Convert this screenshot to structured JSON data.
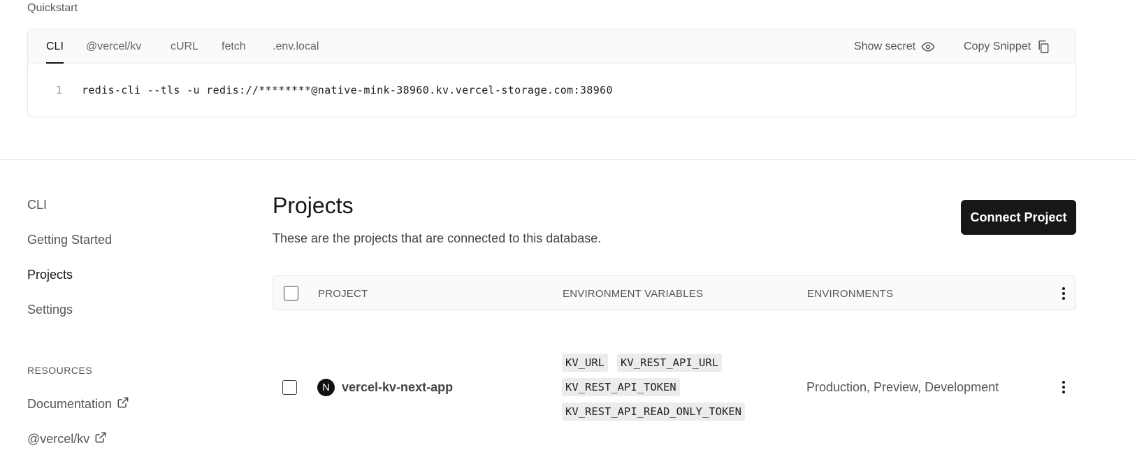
{
  "quickstart": {
    "label": "Quickstart",
    "tabs": [
      {
        "label": "CLI",
        "active": true
      },
      {
        "label": "@vercel/kv",
        "active": false
      },
      {
        "label": "cURL",
        "active": false
      },
      {
        "label": "fetch",
        "active": false
      },
      {
        "label": ".env.local",
        "active": false
      }
    ],
    "show_secret_label": "Show secret",
    "copy_snippet_label": "Copy Snippet",
    "code": {
      "line_number": "1",
      "text": "redis-cli --tls -u redis://********@native-mink-38960.kv.vercel-storage.com:38960"
    }
  },
  "sidebar": {
    "items": [
      {
        "label": "CLI",
        "active": false
      },
      {
        "label": "Getting Started",
        "active": false
      },
      {
        "label": "Projects",
        "active": true
      },
      {
        "label": "Settings",
        "active": false
      }
    ],
    "resources_label": "RESOURCES",
    "links": [
      {
        "label": "Documentation",
        "icon": "external-link-icon"
      },
      {
        "label": "@vercel/kv",
        "icon": "external-link-icon"
      }
    ]
  },
  "projects": {
    "title": "Projects",
    "description": "These are the projects that are connected to this database.",
    "connect_button_label": "Connect Project",
    "table": {
      "headers": {
        "project": "PROJECT",
        "env_vars": "ENVIRONMENT VARIABLES",
        "environments": "ENVIRONMENTS"
      },
      "rows": [
        {
          "icon_letter": "N",
          "name": "vercel-kv-next-app",
          "env_vars": [
            "KV_URL",
            "KV_REST_API_URL",
            "KV_REST_API_TOKEN",
            "KV_REST_API_READ_ONLY_TOKEN"
          ],
          "environments": "Production, Preview, Development"
        }
      ]
    }
  },
  "colors": {
    "primary_button_bg": "#171717",
    "chip_bg": "#ececec",
    "header_bg": "#fafafa"
  }
}
